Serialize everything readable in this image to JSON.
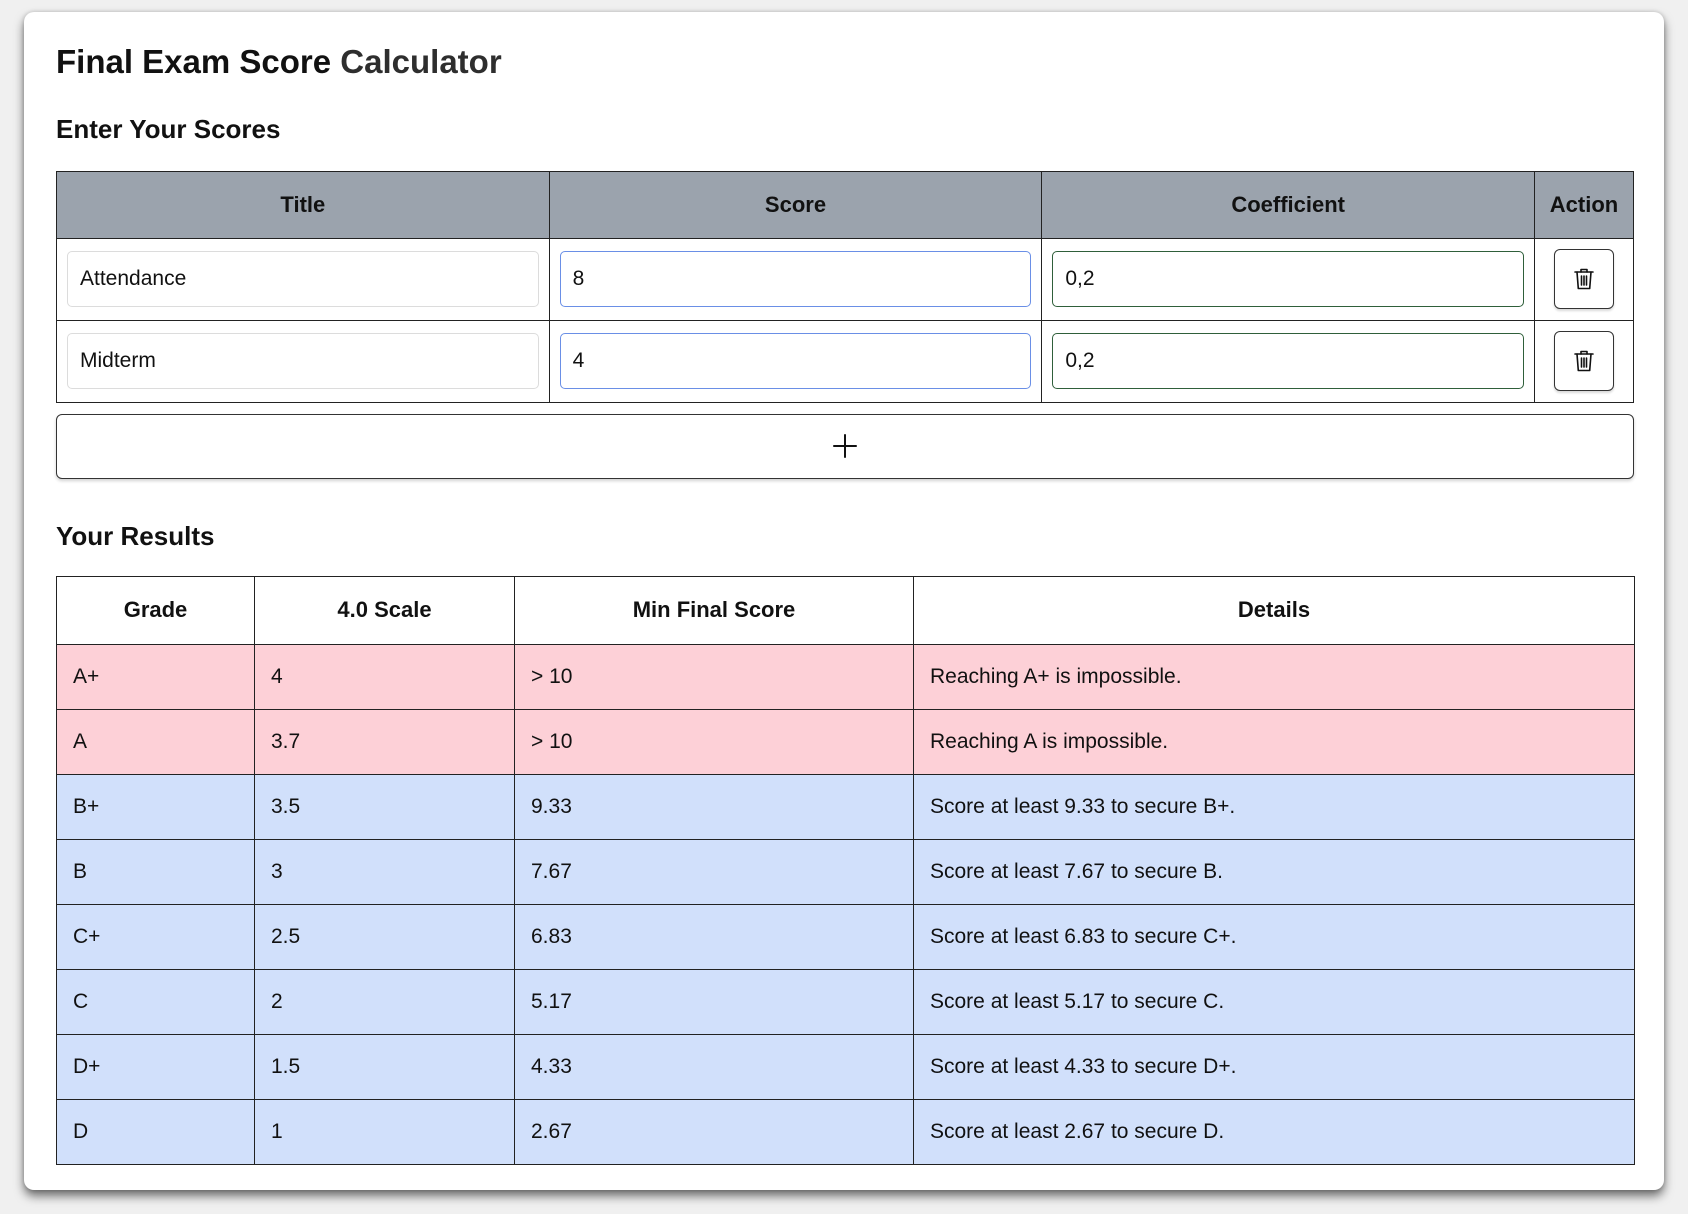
{
  "title_part1": "Final Exam Score",
  "title_part2": "Calculator",
  "scores_section": {
    "heading": "Enter Your Scores",
    "columns": [
      "Title",
      "Score",
      "Coefficient",
      "Action"
    ],
    "rows": [
      {
        "title": "Attendance",
        "score": "8",
        "coefficient": "0,2"
      },
      {
        "title": "Midterm",
        "score": "4",
        "coefficient": "0,2"
      }
    ],
    "delete_icon": "trash-icon",
    "add_icon": "plus-icon"
  },
  "results_section": {
    "heading": "Your Results",
    "columns": [
      "Grade",
      "4.0 Scale",
      "Min Final Score",
      "Details"
    ],
    "rows": [
      {
        "grade": "A+",
        "scale": "4",
        "min": "> 10",
        "details": "Reaching A+ is impossible.",
        "status": "impossible"
      },
      {
        "grade": "A",
        "scale": "3.7",
        "min": "> 10",
        "details": "Reaching A is impossible.",
        "status": "impossible"
      },
      {
        "grade": "B+",
        "scale": "3.5",
        "min": "9.33",
        "details": "Score at least 9.33 to secure B+.",
        "status": "possible"
      },
      {
        "grade": "B",
        "scale": "3",
        "min": "7.67",
        "details": "Score at least 7.67 to secure B.",
        "status": "possible"
      },
      {
        "grade": "C+",
        "scale": "2.5",
        "min": "6.83",
        "details": "Score at least 6.83 to secure C+.",
        "status": "possible"
      },
      {
        "grade": "C",
        "scale": "2",
        "min": "5.17",
        "details": "Score at least 5.17 to secure C.",
        "status": "possible"
      },
      {
        "grade": "D+",
        "scale": "1.5",
        "min": "4.33",
        "details": "Score at least 4.33 to secure D+.",
        "status": "possible"
      },
      {
        "grade": "D",
        "scale": "1",
        "min": "2.67",
        "details": "Score at least 2.67 to secure D.",
        "status": "possible"
      }
    ]
  },
  "colors": {
    "header_gray": "#9ba3ad",
    "impossible_row": "#fdd0d7",
    "possible_row": "#d1e0fb",
    "score_input_border": "#6a8fe6",
    "coefficient_input_border": "#2f5f3a"
  }
}
